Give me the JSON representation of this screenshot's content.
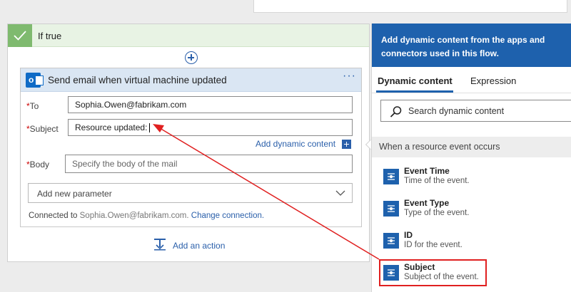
{
  "condition": {
    "title": "If true"
  },
  "email_action": {
    "title": "Send email when virtual machine updated",
    "more_label": "···",
    "fields": {
      "to": {
        "label": "To",
        "value": "Sophia.Owen@fabrikam.com"
      },
      "subject": {
        "label": "Subject",
        "value": "Resource updated:"
      },
      "body": {
        "label": "Body",
        "placeholder": "Specify the body of the mail"
      }
    },
    "add_dynamic_content": "Add dynamic content",
    "add_parameter": "Add new parameter",
    "connected_prefix": "Connected to",
    "connected_account": "Sophia.Owen@fabrikam.com.",
    "change_connection": "Change connection."
  },
  "add_action": "Add an action",
  "panel": {
    "header": "Add dynamic content from the apps and connectors used in this flow.",
    "tabs": [
      "Dynamic content",
      "Expression"
    ],
    "search_placeholder": "Search dynamic content",
    "section": "When a resource event occurs",
    "items": [
      {
        "name": "Event Time",
        "desc": "Time of the event."
      },
      {
        "name": "Event Type",
        "desc": "Type of the event."
      },
      {
        "name": "ID",
        "desc": "ID for the event."
      },
      {
        "name": "Subject",
        "desc": "Subject of the event."
      }
    ]
  },
  "colors": {
    "accent": "#1e61ad",
    "success": "#7fba6f",
    "annotation": "#e02020"
  },
  "icons": [
    "check-icon",
    "add-step-icon",
    "outlook-icon",
    "chevron-down-icon",
    "search-icon",
    "event-grid-icon",
    "add-action-icon"
  ]
}
